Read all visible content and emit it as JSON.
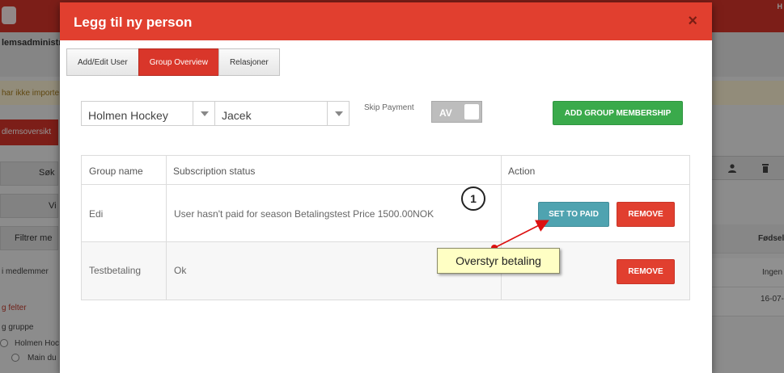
{
  "background": {
    "header_letter": "H",
    "section_title": "lemsadministra",
    "warning_text": "har ikke importe",
    "member_overview_button": "dlemsoversikt",
    "search_button": "Søk",
    "view_button": "Vi",
    "filter_button": "Filtrer me",
    "in_members": "i medlemmer",
    "fields_label": "g felter",
    "group_label": "g gruppe",
    "tree_item_1": "Holmen Hoc",
    "tree_item_2": "Main du",
    "right_header": "Fødsel",
    "right_row_1": "Ingen",
    "right_row_2": "16-07-"
  },
  "modal": {
    "title": "Legg til ny person",
    "close_symbol": "×",
    "tabs": [
      {
        "label": "Add/Edit User"
      },
      {
        "label": "Group Overview"
      },
      {
        "label": "Relasjoner"
      }
    ],
    "club_select": {
      "value": "Holmen Hockey"
    },
    "team_select": {
      "value": "Jacek"
    },
    "skip_payment_label": "Skip Payment",
    "skip_payment_toggle": "AV",
    "add_group_button": "ADD GROUP MEMBERSHIP",
    "table": {
      "headers": [
        "Group name",
        "Subscription status",
        "Action"
      ],
      "rows": [
        {
          "group": "Edi",
          "status": "User hasn't paid for season Betalingstest Price 1500.00NOK",
          "set_paid": "SET TO PAID",
          "remove": "REMOVE"
        },
        {
          "group": "Testbetaling",
          "status": "Ok",
          "remove": "REMOVE"
        }
      ]
    }
  },
  "annotation": {
    "step_number": "1",
    "callout_text": "Overstyr betaling"
  },
  "colors": {
    "brand_red": "#e13f2f",
    "success_green": "#3aaa4b",
    "info_teal": "#4fa3b0",
    "callout_yellow": "#ffffc4"
  }
}
